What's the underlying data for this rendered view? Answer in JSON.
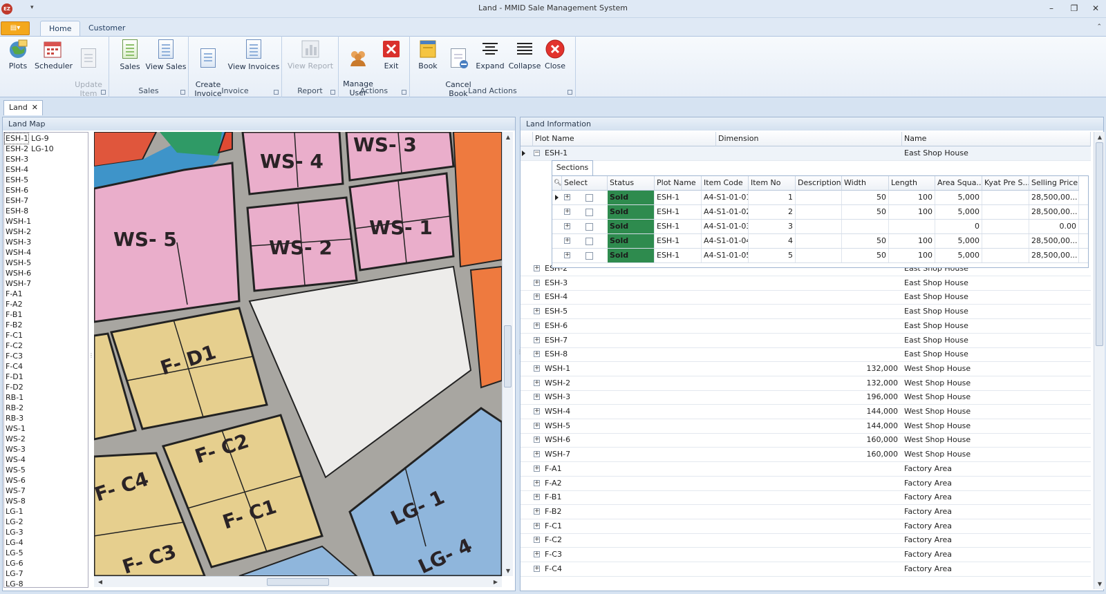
{
  "window": {
    "title": "Land - MMID Sale Management System"
  },
  "ribbon": {
    "tabs": [
      "Home",
      "Customer"
    ],
    "groups": [
      {
        "label": "",
        "buttons": [
          "Plots",
          "Scheduler",
          "Update\nItem"
        ]
      },
      {
        "label": "Sales",
        "buttons": [
          "Sales",
          "View Sales"
        ]
      },
      {
        "label": "Invoice",
        "buttons": [
          "Create\nInvoice",
          "View Invoices"
        ]
      },
      {
        "label": "Report",
        "buttons": [
          "View Report"
        ]
      },
      {
        "label": "Actions",
        "buttons": [
          "Manage\nUser",
          "Exit"
        ]
      },
      {
        "label": "Land Actions",
        "buttons": [
          "Book",
          "Cancel\nBook",
          "Expand",
          "Collapse",
          "Close"
        ]
      }
    ]
  },
  "doc_tab": {
    "label": "Land"
  },
  "land_map": {
    "title": "Land Map",
    "plots_col1": [
      "ESH-1",
      "ESH-2",
      "ESH-3",
      "ESH-4",
      "ESH-5",
      "ESH-6",
      "ESH-7",
      "ESH-8",
      "WSH-1",
      "WSH-2",
      "WSH-3",
      "WSH-4",
      "WSH-5",
      "WSH-6",
      "WSH-7",
      "F-A1",
      "F-A2",
      "F-B1",
      "F-B2",
      "F-C1",
      "F-C2",
      "F-C3",
      "F-C4",
      "F-D1",
      "F-D2",
      "RB-1",
      "RB-2",
      "RB-3",
      "WS-1",
      "WS-2",
      "WS-3",
      "WS-4",
      "WS-5",
      "WS-6",
      "WS-7",
      "WS-8",
      "LG-1",
      "LG-2",
      "LG-3",
      "LG-4",
      "LG-5",
      "LG-6",
      "LG-7",
      "LG-8"
    ],
    "plots_col2": [
      "LG-9",
      "LG-10"
    ],
    "map_labels": [
      "WS- 4",
      "WS- 3",
      "WS- 5",
      "WS- 2",
      "WS- 1",
      "F- D1",
      "F- C2",
      "F- C1",
      "F- C4",
      "F- C3",
      "LG- 1",
      "LG- 4"
    ]
  },
  "land_info": {
    "title": "Land Information",
    "columns": [
      "Plot Name",
      "Dimension",
      "Name"
    ],
    "expanded_row": {
      "plot": "ESH-1",
      "name": "East Shop House"
    },
    "sections_tab": "Sections",
    "detail_columns": [
      "Select",
      "Status",
      "Plot Name",
      "Item Code",
      "Item No",
      "Description",
      "Width",
      "Length",
      "Area Squa...",
      "Kyat Pre S...",
      "Selling Price"
    ],
    "detail_rows": [
      {
        "status": "Sold",
        "plot": "ESH-1",
        "code": "A4-S1-01-01",
        "no": "1",
        "width": "50",
        "length": "100",
        "area": "5,000",
        "price": "28,500,00..."
      },
      {
        "status": "Sold",
        "plot": "ESH-1",
        "code": "A4-S1-01-02",
        "no": "2",
        "width": "50",
        "length": "100",
        "area": "5,000",
        "price": "28,500,00..."
      },
      {
        "status": "Sold",
        "plot": "ESH-1",
        "code": "A4-S1-01-03",
        "no": "3",
        "width": "",
        "length": "",
        "area": "0",
        "price": "0.00"
      },
      {
        "status": "Sold",
        "plot": "ESH-1",
        "code": "A4-S1-01-04",
        "no": "4",
        "width": "50",
        "length": "100",
        "area": "5,000",
        "price": "28,500,00..."
      },
      {
        "status": "Sold",
        "plot": "ESH-1",
        "code": "A4-S1-01-05",
        "no": "5",
        "width": "50",
        "length": "100",
        "area": "5,000",
        "price": "28,500,00..."
      }
    ],
    "rows": [
      {
        "plot": "ESH-2",
        "dim": "",
        "name": "East Shop House"
      },
      {
        "plot": "ESH-3",
        "dim": "",
        "name": "East Shop House"
      },
      {
        "plot": "ESH-4",
        "dim": "",
        "name": "East Shop House"
      },
      {
        "plot": "ESH-5",
        "dim": "",
        "name": "East Shop House"
      },
      {
        "plot": "ESH-6",
        "dim": "",
        "name": "East Shop House"
      },
      {
        "plot": "ESH-7",
        "dim": "",
        "name": "East Shop House"
      },
      {
        "plot": "ESH-8",
        "dim": "",
        "name": "East Shop House"
      },
      {
        "plot": "WSH-1",
        "dim": "132,000",
        "name": "West Shop House"
      },
      {
        "plot": "WSH-2",
        "dim": "132,000",
        "name": "West Shop House"
      },
      {
        "plot": "WSH-3",
        "dim": "196,000",
        "name": "West Shop House"
      },
      {
        "plot": "WSH-4",
        "dim": "144,000",
        "name": "West Shop House"
      },
      {
        "plot": "WSH-5",
        "dim": "144,000",
        "name": "West Shop House"
      },
      {
        "plot": "WSH-6",
        "dim": "160,000",
        "name": "West Shop House"
      },
      {
        "plot": "WSH-7",
        "dim": "160,000",
        "name": "West Shop House"
      },
      {
        "plot": "F-A1",
        "dim": "",
        "name": "Factory Area"
      },
      {
        "plot": "F-A2",
        "dim": "",
        "name": "Factory Area"
      },
      {
        "plot": "F-B1",
        "dim": "",
        "name": "Factory Area"
      },
      {
        "plot": "F-B2",
        "dim": "",
        "name": "Factory Area"
      },
      {
        "plot": "F-C1",
        "dim": "",
        "name": "Factory Area"
      },
      {
        "plot": "F-C2",
        "dim": "",
        "name": "Factory Area"
      },
      {
        "plot": "F-C3",
        "dim": "",
        "name": "Factory Area"
      },
      {
        "plot": "F-C4",
        "dim": "",
        "name": "Factory Area"
      }
    ]
  }
}
